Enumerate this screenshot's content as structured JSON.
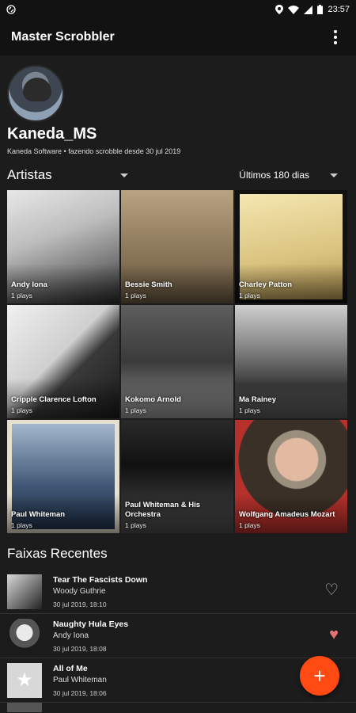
{
  "status_bar": {
    "time": "23:57",
    "left_icon": "sync-icon",
    "icons": [
      "location-icon",
      "wifi-icon",
      "signal-icon",
      "battery-icon"
    ]
  },
  "app_bar": {
    "title": "Master Scrobbler",
    "menu_icon": "overflow-menu-icon"
  },
  "profile": {
    "username": "Kaneda_MS",
    "subtitle": "Kaneda Software • fazendo scrobble desde 30 jul 2019"
  },
  "artists_section": {
    "title": "Artistas",
    "period": "Últimos 180 dias"
  },
  "artists": [
    {
      "name": "Andy Iona",
      "plays": "1 plays"
    },
    {
      "name": "Bessie Smith",
      "plays": "1 plays"
    },
    {
      "name": "Charley Patton",
      "plays": "1 plays"
    },
    {
      "name": "Cripple Clarence Lofton",
      "plays": "1 plays"
    },
    {
      "name": "Kokomo Arnold",
      "plays": "1 plays"
    },
    {
      "name": "Ma Rainey",
      "plays": "1 plays"
    },
    {
      "name": "Paul Whiteman",
      "plays": "1 plays"
    },
    {
      "name": "Paul Whiteman & His Orchestra",
      "plays": "1 plays"
    },
    {
      "name": "Wolfgang Amadeus Mozart",
      "plays": "1 plays"
    }
  ],
  "recent_section": {
    "title": "Faixas Recentes"
  },
  "tracks": [
    {
      "title": "Tear The Fascists Down",
      "artist": "Woody Guthrie",
      "time": "30 jul 2019, 18:10",
      "loved": false
    },
    {
      "title": "Naughty Hula Eyes",
      "artist": "Andy Iona",
      "time": "30 jul 2019, 18:08",
      "loved": true
    },
    {
      "title": "All of Me",
      "artist": "Paul Whiteman",
      "time": "30 jul 2019, 18:06",
      "loved": false
    }
  ],
  "fab": {
    "label": "+",
    "icon": "plus-icon"
  },
  "colors": {
    "background": "#1c1c1c",
    "appbar": "#121212",
    "accent": "#ff4a14",
    "heart_filled": "#e57373"
  }
}
